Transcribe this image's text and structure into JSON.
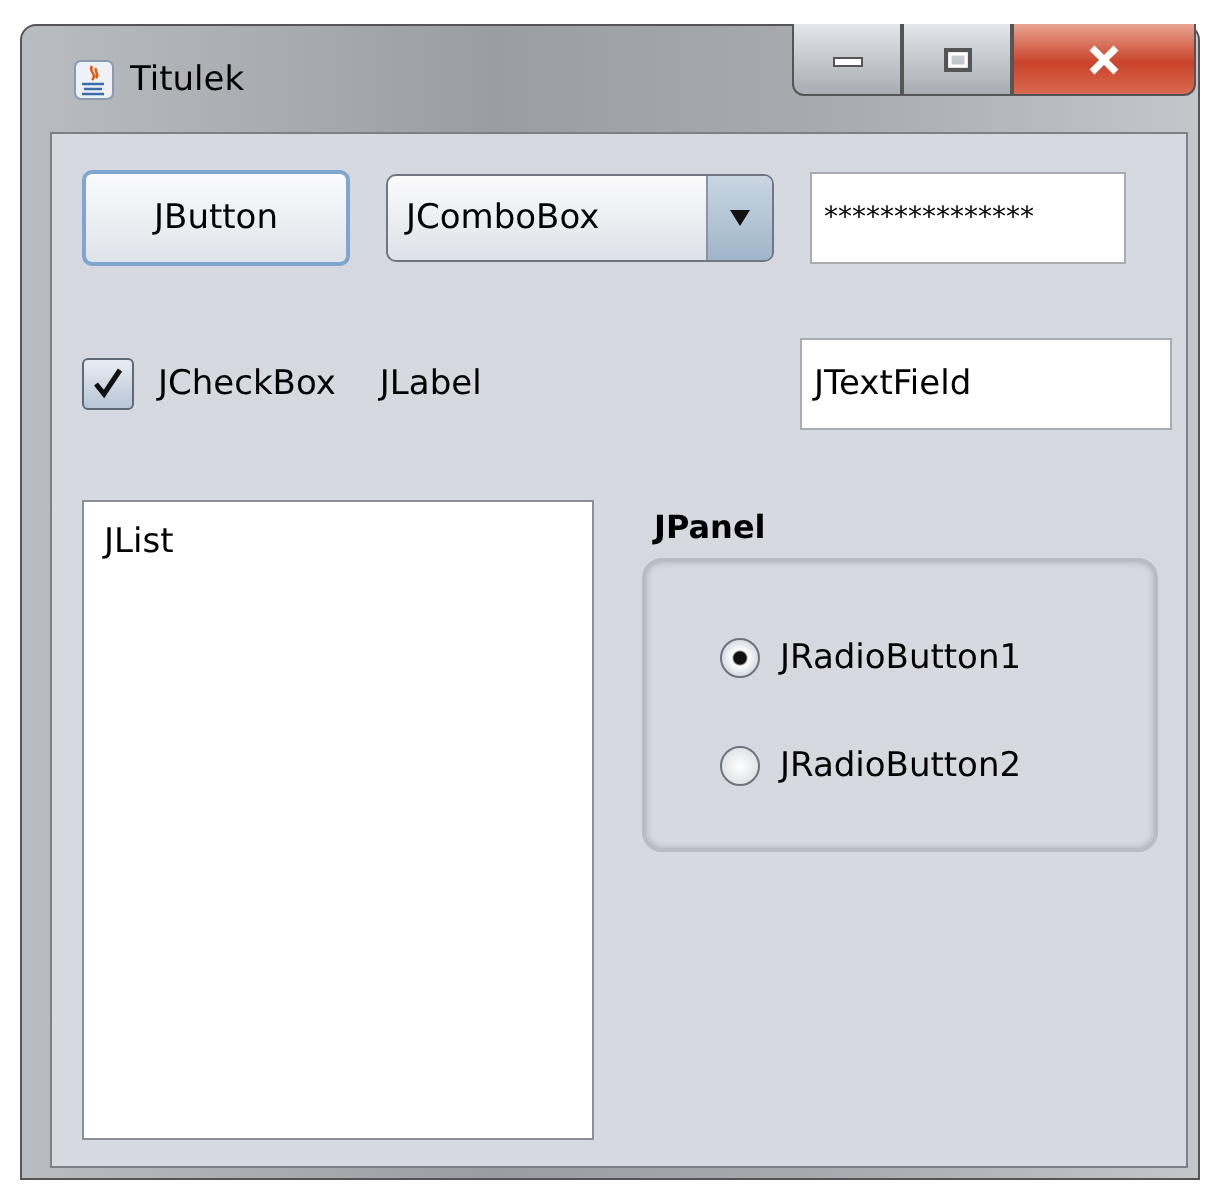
{
  "window": {
    "title": "Titulek"
  },
  "button": {
    "label": "JButton"
  },
  "combo": {
    "value": "JComboBox"
  },
  "password": {
    "value": "***************"
  },
  "checkbox": {
    "label": "JCheckBox",
    "checked": true
  },
  "label": "JLabel",
  "text_field": {
    "value": "JTextField"
  },
  "list": {
    "items": [
      "JList"
    ]
  },
  "panel": {
    "title": "JPanel",
    "radios": [
      {
        "label": "JRadioButton1",
        "selected": true
      },
      {
        "label": "JRadioButton2",
        "selected": false
      }
    ]
  }
}
